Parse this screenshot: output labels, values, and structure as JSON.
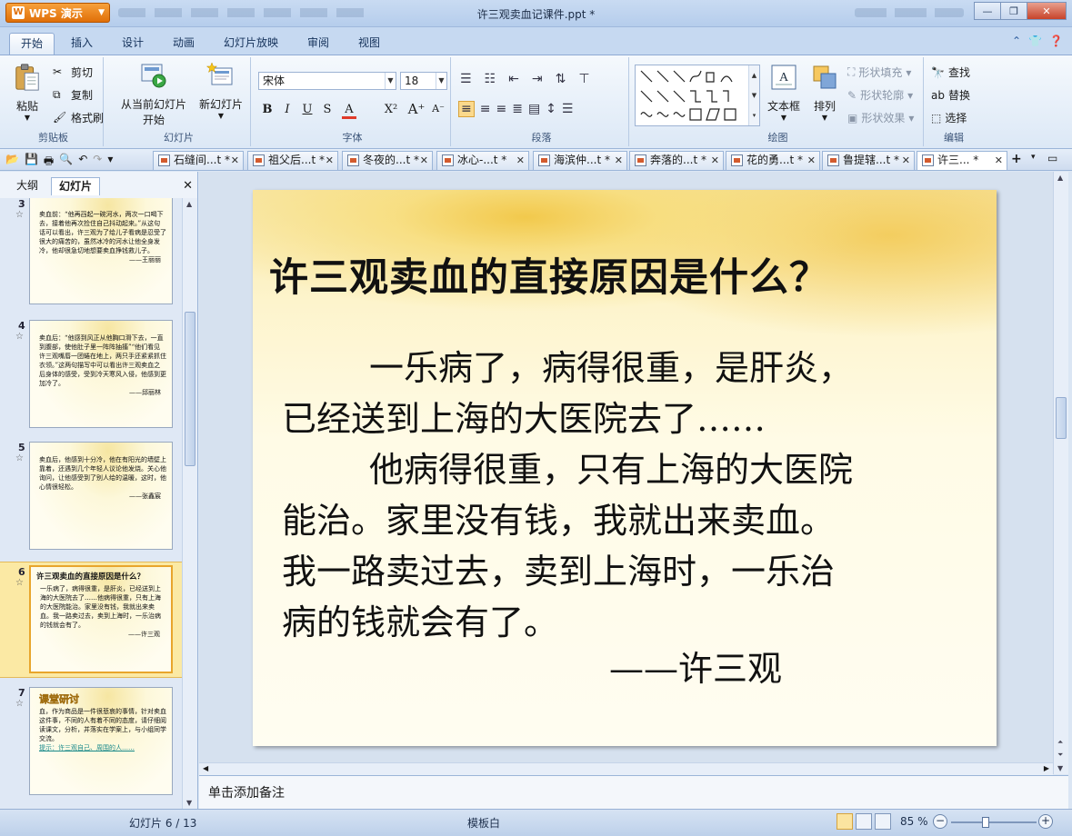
{
  "app": {
    "name": "WPS 演示",
    "window_title": "许三观卖血记课件.ppt *"
  },
  "ribbon_tabs": [
    "开始",
    "插入",
    "设计",
    "动画",
    "幻灯片放映",
    "审阅",
    "视图"
  ],
  "clipboard": {
    "paste": "粘贴",
    "cut": "剪切",
    "copy": "复制",
    "format_painter": "格式刷",
    "label": "剪贴板"
  },
  "slides_group": {
    "from_current_line1": "从当前幻灯片",
    "from_current_line2": "开始",
    "new_slide": "新幻灯片",
    "label": "幻灯片"
  },
  "font_group": {
    "font_name": "宋体",
    "font_size": "18",
    "label": "字体"
  },
  "paragraph_group": {
    "label": "段落"
  },
  "drawing_group": {
    "text_box": "文本框",
    "arrange": "排列",
    "shape_fill": "形状填充",
    "shape_outline": "形状轮廓",
    "shape_effect": "形状效果",
    "label": "绘图"
  },
  "editing_group": {
    "find": "查找",
    "replace": "替换",
    "select": "选择",
    "label": "编辑"
  },
  "doc_tabs": [
    "石缝间...t *",
    "祖父后...t *",
    "冬夜的...t *",
    "冰心-...t *",
    "海滨仲...t *",
    "奔落的...t *",
    "花的勇...t *",
    "鲁提辖...t *",
    "许三... *"
  ],
  "left_panel": {
    "tabs": [
      "大纲",
      "幻灯片"
    ],
    "thumbnails": [
      {
        "number": "3",
        "text": "卖血前：“他再舀起一碗河水，两次一口喝下去，接着他再次捡住自己抖动起来。”从这句话可以看出，许三观为了给儿子看病是忍受了很大的痛苦的，虽然冰冷的河水让他全身发冷，他却很急切地想要卖血挣钱救儿子。",
        "sig": "——王丽丽"
      },
      {
        "number": "4",
        "text": "卖血后：“他感到风正从他胸口滑下去，一直到腹部，使他肚子里一阵阵抽搐”“他们看见许三观嘴唇一团蜷在地上，两只手还紧紧抓住衣领。”这两句描写中可以看出许三观卖血之后身体的感受，受到冷天寒风入侵，他感到更加冷了。",
        "sig": "——邱丽林"
      },
      {
        "number": "5",
        "text": "卖血后，他感到十分冷，他在有阳光的墙壁上靠着，还遇到几个年轻人议论他发烧。关心他询问，让他感受到了别人给的温暖，这时，他心情很轻松。",
        "sig": "——张鑫宸"
      },
      {
        "number": "6",
        "title": "许三观卖血的直接原因是什么？",
        "text": "一乐病了，病得很重，是肝炎，已经送到上海的大医院去了……他病得很重，只有上海的大医院能治。家里没有钱，我就出来卖血。我一路卖过去，卖到上海时，一乐治病的钱就会有了。",
        "sig": "——许三观"
      },
      {
        "number": "7",
        "heading": "课堂研讨",
        "text": "血，作为商品是一件很悲哀的事情，针对卖血这件事，不同的人有着不同的态度，请仔细阅读课文，分析，并落实在学案上，与小组同学交流。",
        "hint": "提示：许三观自己、周围的人……"
      }
    ]
  },
  "slide": {
    "title": "许三观卖血的直接原因是什么？",
    "para1_line1": "一乐病了，病得很重，是肝炎，",
    "para1_line2": "已经送到上海的大医院去了……",
    "para2_line1": "他病得很重，只有上海的大医院",
    "para2_line2": "能治。家里没有钱，我就出来卖血。",
    "para2_line3": "我一路卖过去，卖到上海时，一乐治",
    "para2_line4": "病的钱就会有了。",
    "signature": "——许三观"
  },
  "notes_placeholder": "单击添加备注",
  "status": {
    "slide_position": "幻灯片 6 / 13",
    "template": "模板白",
    "zoom": "85 %"
  }
}
